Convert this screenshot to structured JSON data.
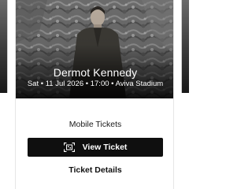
{
  "event": {
    "artist": "Dermot Kennedy",
    "day": "Sat",
    "date": "11 Jul 2026",
    "time": "17:00",
    "venue": "Aviva Stadium",
    "separator": " • "
  },
  "tickets": {
    "section_label": "Mobile Tickets",
    "view_button_label": "View Ticket",
    "view_button_icon": "ticket-scan-icon",
    "details_link_label": "Ticket Details"
  },
  "colors": {
    "button_bg": "#0f0f0f",
    "button_text": "#ffffff",
    "hero_overlay": "#1a1a1a"
  }
}
